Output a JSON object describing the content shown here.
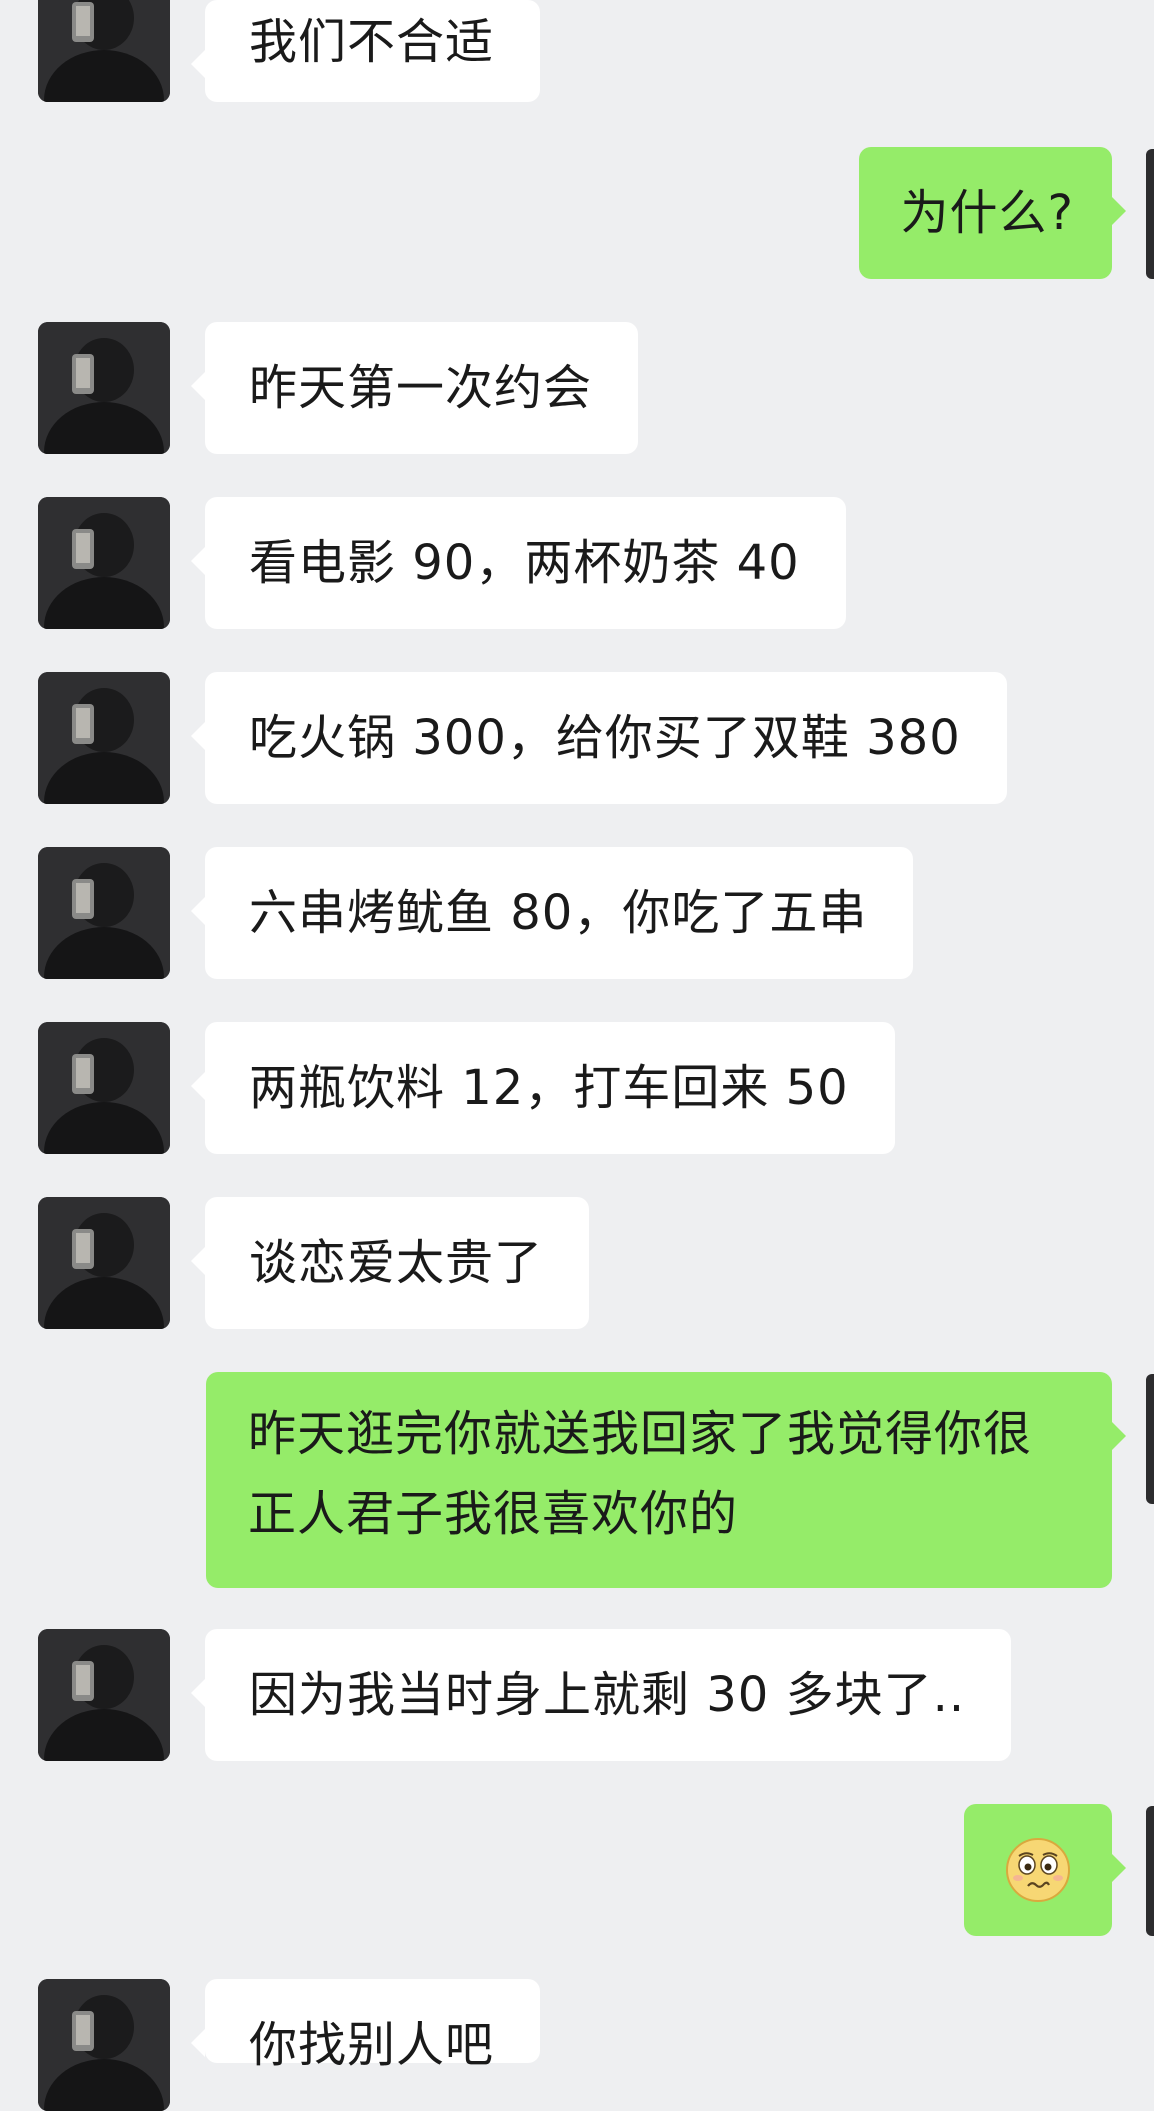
{
  "messages": [
    {
      "from": "contact",
      "text": "我们不合适"
    },
    {
      "from": "me",
      "text": "为什么?"
    },
    {
      "from": "contact",
      "text": "昨天第一次约会"
    },
    {
      "from": "contact",
      "text": "看电影 90，两杯奶茶 40"
    },
    {
      "from": "contact",
      "text": "吃火锅 300，给你买了双鞋 380"
    },
    {
      "from": "contact",
      "text": "六串烤鱿鱼 80，你吃了五串"
    },
    {
      "from": "contact",
      "text": "两瓶饮料 12，打车回来 50"
    },
    {
      "from": "contact",
      "text": "谈恋爱太贵了"
    },
    {
      "from": "me",
      "text": "昨天逛完你就送我回家了我觉得你很正人君子我很喜欢你的"
    },
    {
      "from": "contact",
      "text": "因为我当时身上就剩 30 多块了.."
    },
    {
      "from": "me",
      "emoji": "worried-face"
    },
    {
      "from": "contact",
      "text": "你找别人吧"
    }
  ],
  "colors": {
    "background": "#eeeff1",
    "incoming_bubble": "#ffffff",
    "outgoing_bubble": "#95ec69",
    "text": "#1a1a1a"
  }
}
